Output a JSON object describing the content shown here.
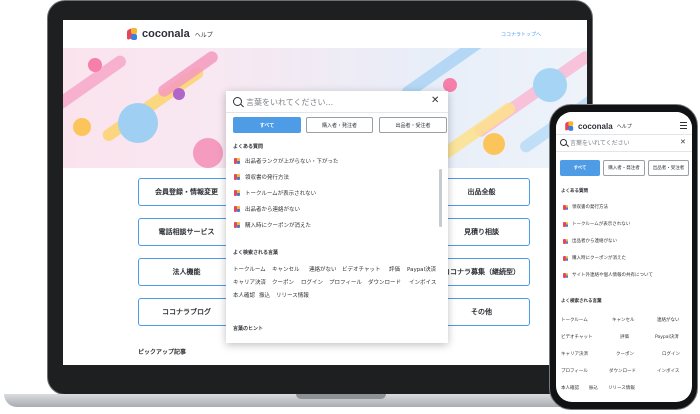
{
  "site": {
    "logo_text": "coconala",
    "logo_sub": "ヘルプ",
    "top_link": "ココナラトップへ"
  },
  "categories": [
    "会員登録・情報変更",
    "電話相談サービス",
    "法人機能",
    "ココナラブログ",
    "出品全般",
    "見積り相談",
    "ココナラ募集（継続型）",
    "その他"
  ],
  "pickup_title": "ピックアップ記事",
  "search": {
    "placeholder": "言葉をいれてください...",
    "close_icon": "✕",
    "tabs": [
      "すべて",
      "購入者・発注者",
      "出品者・受注者"
    ],
    "active_tab": "すべて",
    "faq_title": "よくある質問",
    "faq": [
      "出品者ランクが上がらない・下がった",
      "領収書の発行方法",
      "トークルームが表示されない",
      "出品者から連絡がない",
      "購入時にクーポンが消えた"
    ],
    "keywords_title": "よく検索される言葉",
    "keywords": [
      "トークルーム",
      "キャンセル",
      "連絡がない",
      "ビデオチャット",
      "評価",
      "Paypal決済",
      "キャリア決済",
      "クーポン",
      "ログイン",
      "プロフィール",
      "ダウンロード",
      "インボイス",
      "本人確認",
      "振込",
      "リリース情報"
    ],
    "hint_title": "言葉のヒント"
  },
  "phone": {
    "placeholder": "言葉をいれてください",
    "tabs": [
      "すべて",
      "購入者・発注者",
      "出品者・受注者"
    ],
    "faq_title": "よくある質問",
    "faq": [
      "領収書の発行方法",
      "トークルームが表示されない",
      "出品者から連絡がない",
      "購入時にクーポンが消えた",
      "サイト外連絡や個人情報の共有について"
    ],
    "keywords_title": "よく検索される言葉",
    "keywords": [
      "トークルーム",
      "キャンセル",
      "連絡がない",
      "ビデオチャット",
      "評価",
      "Paypal決済",
      "キャリア決済",
      "クーポン",
      "ログイン",
      "プロフィール",
      "ダウンロード",
      "インボイス",
      "本人確認",
      "振込",
      "リリース情報"
    ]
  },
  "colors": {
    "accent": "#4e9be6",
    "logo_red": "#e8445a",
    "logo_yellow": "#f7b52c",
    "logo_blue": "#3d7fe0"
  }
}
